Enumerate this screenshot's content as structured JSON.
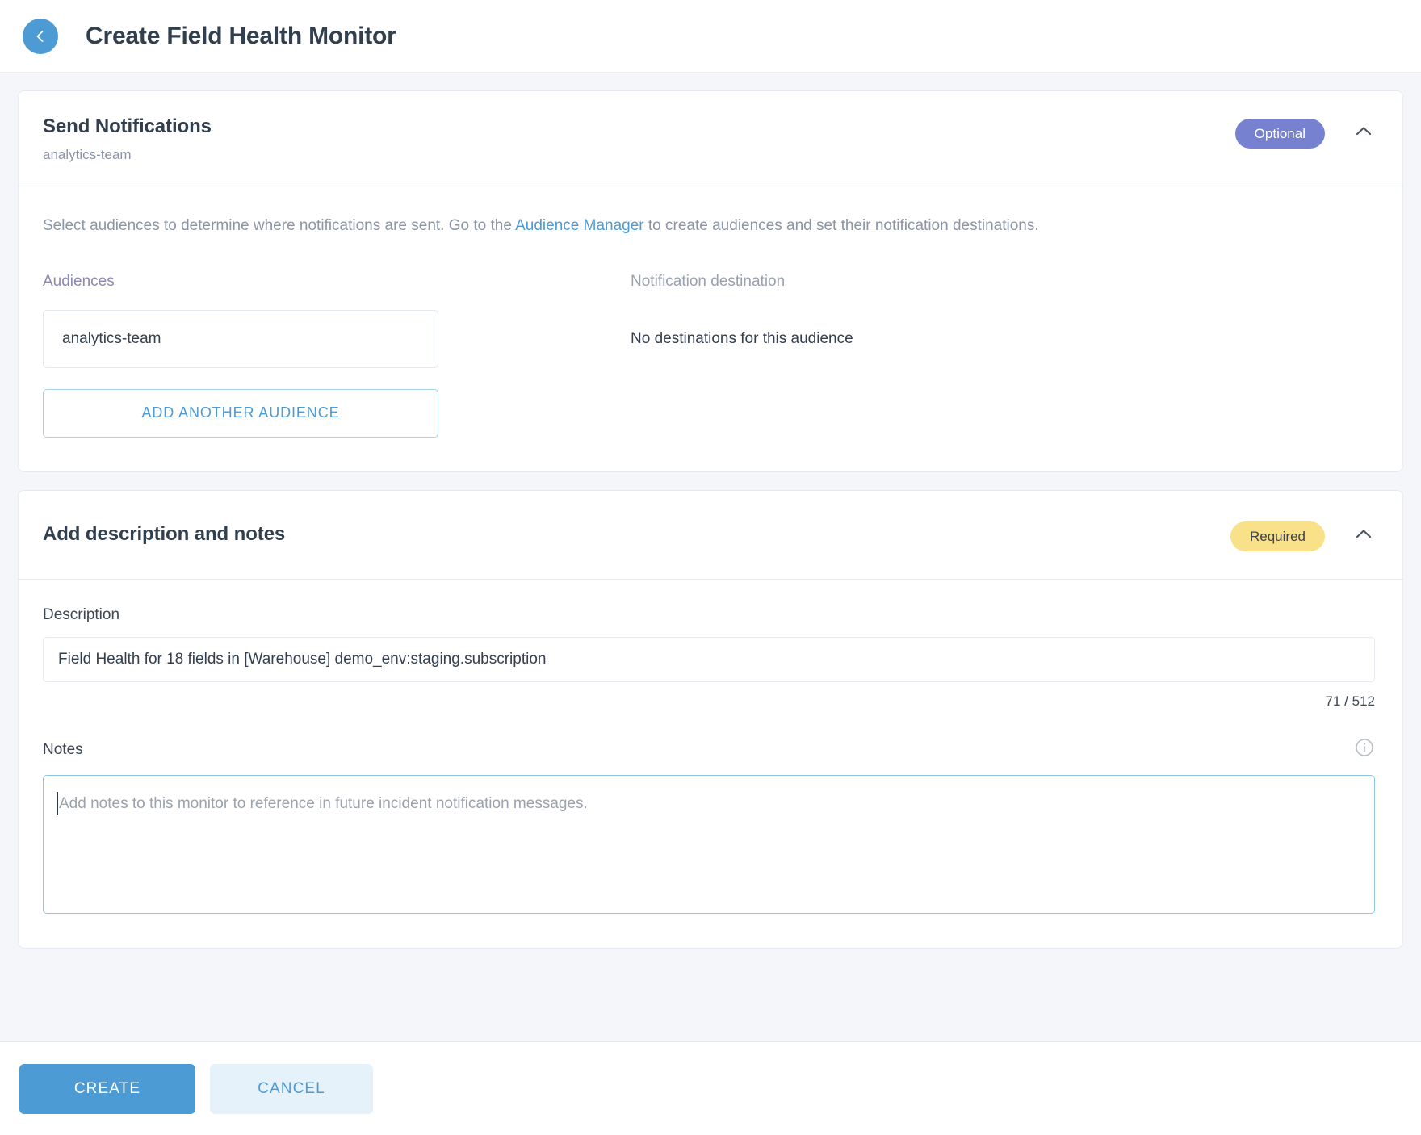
{
  "header": {
    "back_icon": "chevron-left-icon",
    "title": "Create Field Health Monitor"
  },
  "notifications_card": {
    "title": "Send Notifications",
    "subtitle": "analytics-team",
    "badge": "Optional",
    "collapse_icon": "chevron-up-icon",
    "description_before_link": "Select audiences to determine where notifications are sent. Go to the ",
    "description_link": "Audience Manager",
    "description_after_link": " to create audiences and set their notification destinations.",
    "audiences_label": "Audiences",
    "audience_value": "analytics-team",
    "add_audience_label": "ADD ANOTHER AUDIENCE",
    "destination_label": "Notification destination",
    "destination_value": "No destinations for this audience"
  },
  "description_card": {
    "title": "Add description and notes",
    "badge": "Required",
    "collapse_icon": "chevron-up-icon",
    "description_label": "Description",
    "description_value": "Field Health for 18 fields in [Warehouse] demo_env:staging.subscription",
    "char_counter": "71 / 512",
    "notes_label": "Notes",
    "notes_info_icon": "info-circle-icon",
    "notes_value": "",
    "notes_placeholder": "Add notes to this monitor to reference in future incident notification messages."
  },
  "footer": {
    "create_label": "CREATE",
    "cancel_label": "CANCEL"
  },
  "colors": {
    "accent_blue": "#4d9bd4",
    "badge_optional": "#7681d0",
    "badge_required": "#f9e189",
    "page_background": "#f4f6fa",
    "text_dark": "#313f4e",
    "text_muted": "#8a95a5"
  }
}
